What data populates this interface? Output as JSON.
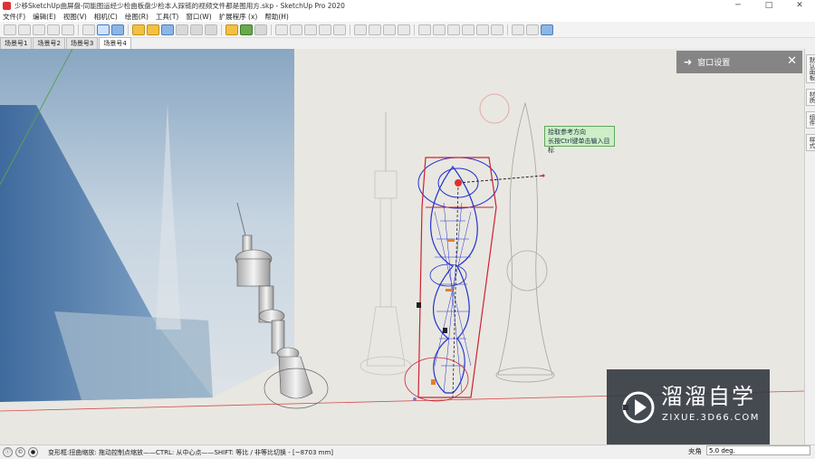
{
  "window": {
    "title": "少移SketchUp曲屏盘-同能图运经少检曲板盘少检本人踩链的视频文件都是图用方.skp - SketchUp Pro 2020",
    "minimize": "─",
    "maximize": "□",
    "close": "✕"
  },
  "menu": [
    "文件(F)",
    "编辑(E)",
    "视图(V)",
    "相机(C)",
    "绘图(R)",
    "工具(T)",
    "窗口(W)",
    "扩展程序 (x)",
    "帮助(H)"
  ],
  "scene_tabs": [
    "场景号1",
    "场景号2",
    "场景号3",
    "场景号4"
  ],
  "active_scene": 3,
  "tray": {
    "title": "窗口设置",
    "arrow": "➜",
    "close": "✕"
  },
  "right_tray_tabs": [
    "默认面板",
    "材质",
    "组件",
    "样式"
  ],
  "tooltip": {
    "line1": "拾取参考方向",
    "line2": "长按Ctrl键单击输入目标"
  },
  "status": {
    "text": "变形框:扭曲缩放: 拖动控制点缩放——CTRL: 从中心点——SHIFT: 等比 / 非等比切换 - [~8703 mm]"
  },
  "vcb": {
    "label": "夹角",
    "value": "5.0 deg."
  },
  "watermark": {
    "name": "溜溜自学",
    "url": "ZIXUE.3D66.COM"
  },
  "colors": {
    "selection_blue": "#2233cc",
    "selection_red": "#cc2233",
    "inference_red": "#e05050"
  }
}
